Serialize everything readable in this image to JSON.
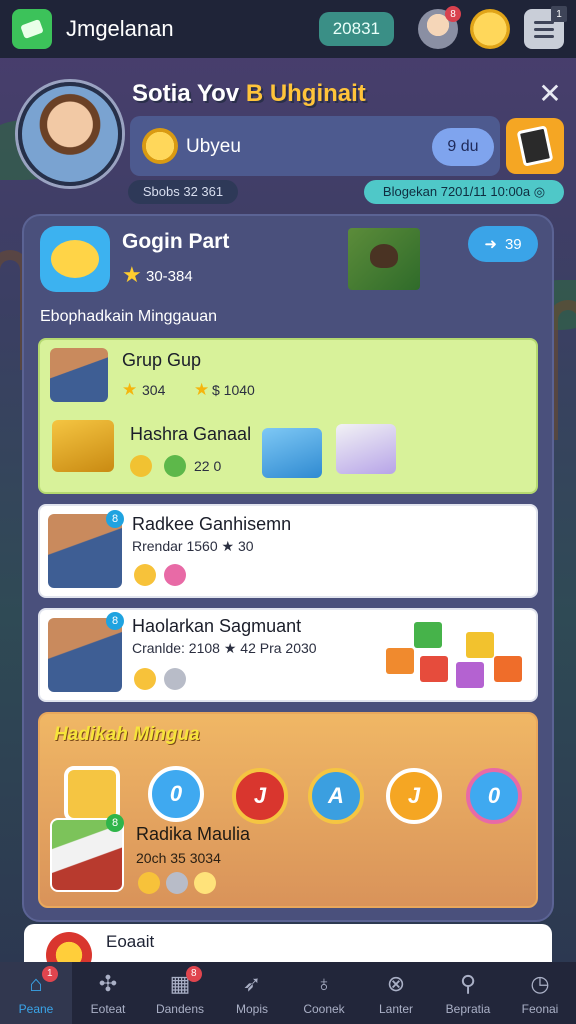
{
  "topbar": {
    "app_title": "Jmgelanan",
    "coin_value": "20831",
    "avatar_badge": "8",
    "menu_badge": "1",
    "icons": [
      "app-logo-icon",
      "avatar-icon",
      "coin-icon",
      "menu-icon"
    ]
  },
  "profile": {
    "name_part1": "Sotia Yov ",
    "name_part2": "B Uhginait",
    "panel_label": "Ubyeu",
    "panel_pill": "9 du",
    "stats": "Sbobs 32 361",
    "date": "Blogekan 7201/11 10:00a ◎"
  },
  "event": {
    "title": "Gogin Part",
    "score": "30-384",
    "share_value": "39",
    "section_heading": "Ebophadkain Minggauan"
  },
  "cards": [
    {
      "title": "Grup Gup",
      "sub_left": "304",
      "sub_right": "$ 1040",
      "reward_title": "Hashra Ganaal",
      "reward_values": "22 0"
    },
    {
      "badge": "8",
      "title": "Radkee Ganhisemn",
      "sub": "Rrendar 1560 ★ 30"
    },
    {
      "badge": "8",
      "title": "Haolarkan Sagmuant",
      "sub": "Cranlde: 2108 ★ 42 Pra 2030"
    }
  ],
  "weekly": {
    "title": "Hadikah Mingua",
    "medals": [
      "",
      "0",
      "J",
      "A",
      "J",
      "0"
    ],
    "badge": "8",
    "name": "Radika Maulia",
    "sub": "20ch 35 3034"
  },
  "bottom_card": {
    "title": "Eoaait"
  },
  "nav": [
    {
      "label": "Peane",
      "icon": "home-icon",
      "badge": "1",
      "active": true
    },
    {
      "label": "Eoteat",
      "icon": "puzzle-icon",
      "badge": "",
      "active": false
    },
    {
      "label": "Dandens",
      "icon": "grid-icon",
      "badge": "8",
      "active": false
    },
    {
      "label": "Mopis",
      "icon": "rocket-icon",
      "badge": "",
      "active": false
    },
    {
      "label": "Coonek",
      "icon": "joystick-icon",
      "badge": "",
      "active": false
    },
    {
      "label": "Lanter",
      "icon": "crossed-circle-icon",
      "badge": "",
      "active": false
    },
    {
      "label": "Bepratia",
      "icon": "search-icon",
      "badge": "",
      "active": false
    },
    {
      "label": "Feonai",
      "icon": "clock-icon",
      "badge": "",
      "active": false
    }
  ],
  "colors": {
    "accent_blue": "#3aa4e8",
    "coin_gold": "#ffcd2e",
    "green_card": "#d8f29a",
    "weekly_orange": "#f0b765"
  }
}
